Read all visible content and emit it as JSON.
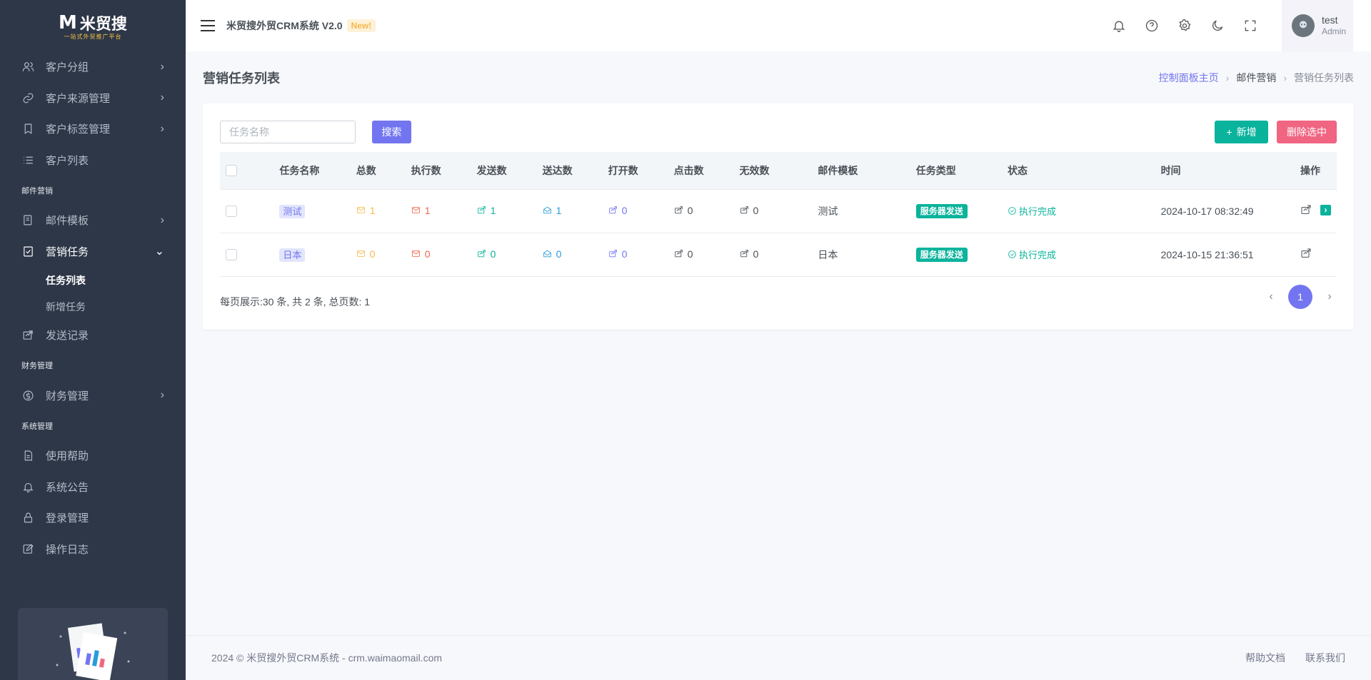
{
  "brand": {
    "logo_text": "米贸搜",
    "logo_sub": "一站式外贸推广平台"
  },
  "sidebar": {
    "items": [
      {
        "label": "客户分组",
        "icon": "users-icon",
        "chevron": "›"
      },
      {
        "label": "客户来源管理",
        "icon": "link-icon",
        "chevron": "›"
      },
      {
        "label": "客户标签管理",
        "icon": "bookmark-icon",
        "chevron": "›"
      },
      {
        "label": "客户列表",
        "icon": "list-icon"
      }
    ],
    "section_mail": "邮件营销",
    "mail_items": [
      {
        "label": "邮件模板",
        "icon": "mail-icon",
        "chevron": "›"
      },
      {
        "label": "营销任务",
        "icon": "task-icon",
        "chevron": "⌄"
      }
    ],
    "task_sub": [
      "任务列表",
      "新增任务"
    ],
    "send_record": {
      "label": "发送记录",
      "icon": "send-icon"
    },
    "section_finance": "财务管理",
    "finance_item": {
      "label": "财务管理",
      "icon": "dollar-icon",
      "chevron": "›"
    },
    "section_system": "系统管理",
    "system_items": [
      {
        "label": "使用帮助",
        "icon": "file-icon"
      },
      {
        "label": "系统公告",
        "icon": "bell-icon"
      },
      {
        "label": "登录管理",
        "icon": "lock-icon"
      },
      {
        "label": "操作日志",
        "icon": "edit-icon"
      }
    ]
  },
  "topbar": {
    "title": "米贸搜外贸CRM系统 V2.0",
    "badge": "New!",
    "user_name": "test",
    "user_role": "Admin"
  },
  "page": {
    "title": "营销任务列表",
    "breadcrumb": [
      "控制面板主页",
      "邮件营销",
      "营销任务列表"
    ],
    "sep": "›"
  },
  "toolbar": {
    "search_placeholder": "任务名称",
    "search_label": "搜索",
    "add_label": "新增",
    "add_prefix": "+",
    "delete_label": "删除选中"
  },
  "table": {
    "headers": [
      "任务名称",
      "总数",
      "执行数",
      "发送数",
      "送达数",
      "打开数",
      "点击数",
      "无效数",
      "邮件模板",
      "任务类型",
      "状态",
      "时间",
      "操作"
    ],
    "rows": [
      {
        "name": "测试",
        "total": "1",
        "executed": "1",
        "sent": "1",
        "delivered": "1",
        "opened": "0",
        "clicked": "0",
        "invalid": "0",
        "template": "测试",
        "type": "服务器发送",
        "status": "执行完成",
        "time": "2024-10-17 08:32:49",
        "action_go": "›"
      },
      {
        "name": "日本",
        "total": "0",
        "executed": "0",
        "sent": "0",
        "delivered": "0",
        "opened": "0",
        "clicked": "0",
        "invalid": "0",
        "template": "日本",
        "type": "服务器发送",
        "status": "执行完成",
        "time": "2024-10-15 21:36:51"
      }
    ]
  },
  "pagination": {
    "info": "每页展示:30 条, 共 2 条, 总页数: 1",
    "prev": "‹",
    "current": "1",
    "next": "›"
  },
  "footer": {
    "copyright": "2024 © 米贸搜外贸CRM系统 - crm.waimaomail.com",
    "help": "帮助文档",
    "contact": "联系我们"
  },
  "colors": {
    "primary": "#7375f0",
    "success": "#0ab39c",
    "danger": "#f06582",
    "sidebar_bg": "#2e3748"
  }
}
